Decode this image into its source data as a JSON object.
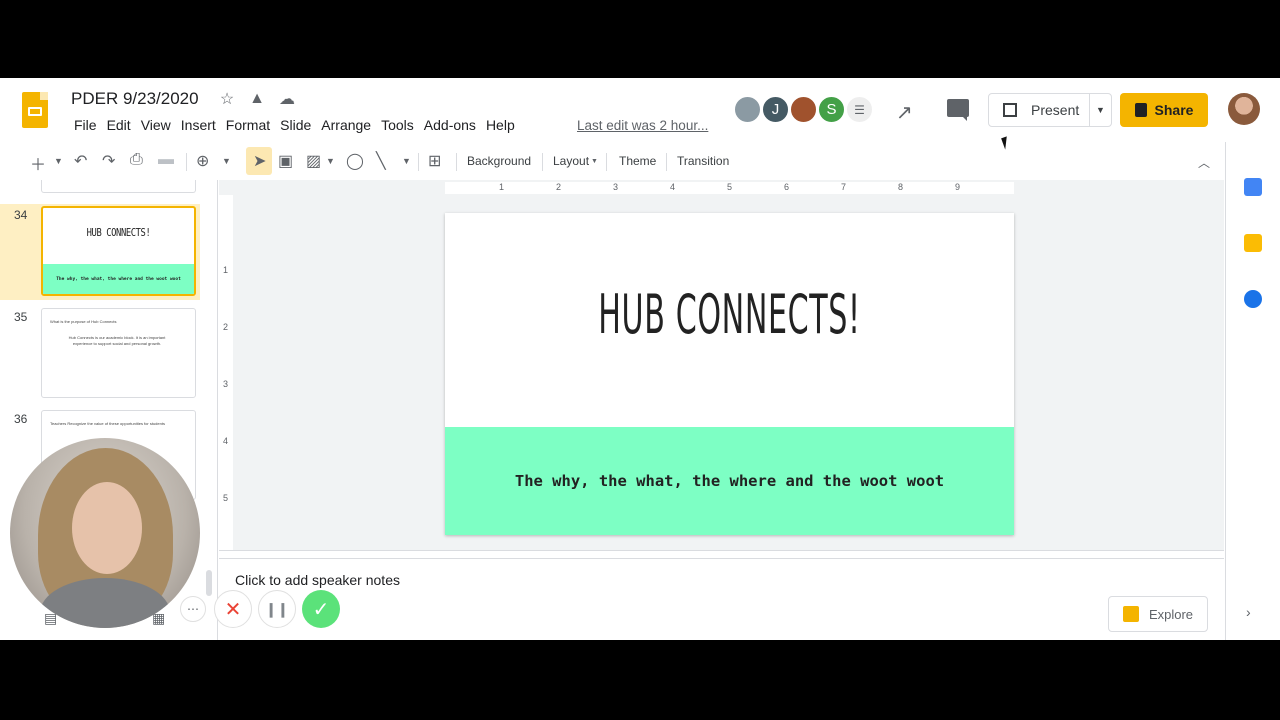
{
  "document": {
    "title": "PDER 9/23/2020"
  },
  "menu": [
    "File",
    "Edit",
    "View",
    "Insert",
    "Format",
    "Slide",
    "Arrange",
    "Tools",
    "Add-ons",
    "Help"
  ],
  "last_edit": "Last edit was 2 hour...",
  "collaborators": [
    {
      "initial": "",
      "color": "#8b9aa3"
    },
    {
      "initial": "J",
      "color": "#455a64"
    },
    {
      "initial": "",
      "color": "#a0522d"
    },
    {
      "initial": "S",
      "color": "#43a047"
    },
    {
      "initial": "",
      "color": "#e0e0e0"
    }
  ],
  "header_buttons": {
    "present": "Present",
    "share": "Share"
  },
  "toolbar": {
    "background": "Background",
    "layout": "Layout",
    "theme": "Theme",
    "transition": "Transition"
  },
  "filmstrip": {
    "slides": [
      {
        "number": "34",
        "title": "HUB CONNECTS!",
        "subtitle": "The why, the what, the where and the woot woot"
      },
      {
        "number": "35",
        "title": "What is the purpose of Hub Connects",
        "body": "Hub Connects is our academic block. It is an important experience to support social and personal growth."
      },
      {
        "number": "36",
        "title": "Teachers Recognize the value of these opportunities for students"
      }
    ]
  },
  "slide": {
    "title": "HUB CONNECTS!",
    "subtitle": "The why, the what, the where and the woot woot"
  },
  "ruler_h": [
    "1",
    "2",
    "3",
    "4",
    "5",
    "6",
    "7",
    "8",
    "9"
  ],
  "ruler_v": [
    "1",
    "2",
    "3",
    "4",
    "5"
  ],
  "speaker_notes": "Click to add speaker notes",
  "explore": "Explore",
  "colors": {
    "accent": "#f4b400",
    "slide_band": "#7dffc4",
    "record_done": "#5be27a"
  },
  "icons": [
    "star-icon",
    "drive-icon",
    "cloud-icon",
    "trend-icon",
    "comment-icon",
    "present-icon",
    "lock-icon",
    "calendar-icon",
    "keep-icon",
    "tasks-icon"
  ]
}
